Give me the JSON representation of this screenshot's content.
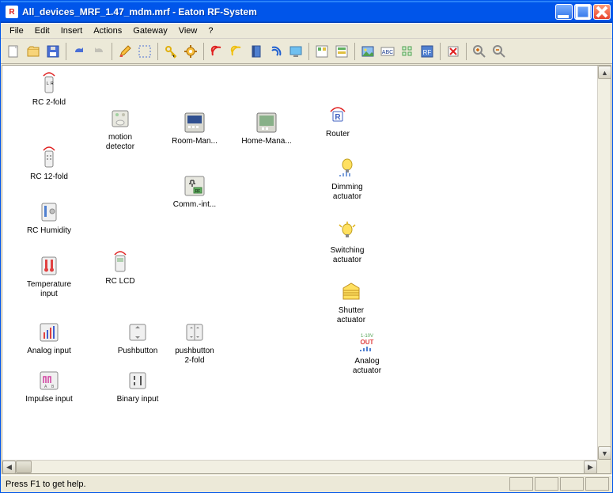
{
  "window": {
    "title": "All_devices_MRF_1.47_mdm.mrf - Eaton RF-System"
  },
  "menu": {
    "file": "File",
    "edit": "Edit",
    "insert": "Insert",
    "actions": "Actions",
    "gateway": "Gateway",
    "view": "View",
    "help": "?"
  },
  "status": {
    "message": "Press F1 to get help."
  },
  "devices": {
    "rc2fold": "RC 2-fold",
    "motion": "motion\ndetector",
    "roommgr": "Room-Man...",
    "homemgr": "Home-Mana...",
    "router": "Router",
    "rc12fold": "RC 12-fold",
    "commint": "Comm.-int...",
    "dimact": "Dimming\nactuator",
    "rchumidity": "RC Humidity",
    "switchact": "Switching\nactuator",
    "tempinput": "Temperature\ninput",
    "rclcd": "RC LCD",
    "shutteract": "Shutter\nactuator",
    "analoginput": "Analog input",
    "pushbutton": "Pushbutton",
    "pushbutton2": "pushbutton\n2-fold",
    "analogact": "Analog\nactuator",
    "impulseinput": "Impulse input",
    "binaryinput": "Binary input"
  }
}
